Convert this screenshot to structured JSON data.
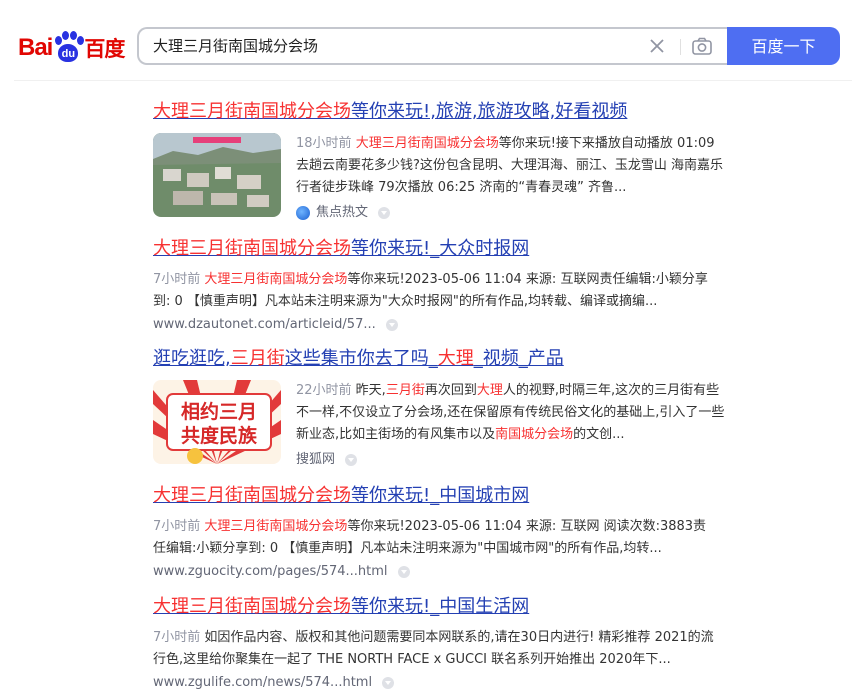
{
  "logo": {
    "bai": "Bai",
    "du": "du",
    "baidu": "百度"
  },
  "search": {
    "query": "大理三月街南国城分会场",
    "button_label": "百度一下"
  },
  "results": [
    {
      "title_parts": [
        "大理三月街南国城分会场",
        "等你来玩!,旅游,旅游攻略,好看视频"
      ],
      "time": "18小时前",
      "snippet_hl": "大理三月街南国城分会场",
      "snippet_rest": "等你来玩!接下来播放自动播放 01:09 去趟云南要花多少钱?这份包含昆明、大理洱海、丽江、玉龙雪山 海南嘉乐行者徒步珠峰 79次播放 06:25 济南的“青春灵魂” 齐鲁...",
      "source": "焦点热文"
    },
    {
      "title_parts": [
        "大理三月街南国城分会场",
        "等你来玩!_大众时报网"
      ],
      "time": "7小时前",
      "snippet_hl": "大理三月街南国城分会场",
      "snippet_rest": "等你来玩!2023-05-06 11:04 来源: 互联网责任编辑:小颖分享到: 0 【慎重声明】凡本站未注明来源为\"大众时报网\"的所有作品,均转载、编译或摘编...",
      "url": "www.dzautonet.com/articleid/57..."
    },
    {
      "title_parts": [
        "逛吃逛吃,",
        "三月街",
        "这些集市你去了吗_",
        "大理",
        "_视频_产品"
      ],
      "time": "22小时前",
      "snippet_parts": [
        " 昨天,",
        "三月街",
        "再次回到",
        "大理",
        "人的视野,时隔三年,这次的三月街有些不一样,不仅设立了分会场,还在保留原有传统民俗文化的基础上,引入了一些新业态,比如主街场的有风集市以及",
        "南国城分会场",
        "的文创..."
      ],
      "thumb_text": [
        "相约三月",
        "共度民族"
      ],
      "source": "搜狐网"
    },
    {
      "title_parts": [
        "大理三月街南国城分会场",
        "等你来玩!_中国城市网"
      ],
      "time": "7小时前",
      "snippet_hl": "大理三月街南国城分会场",
      "snippet_rest": "等你来玩!2023-05-06 11:04 来源: 互联网 阅读次数:3883责任编辑:小颖分享到: 0 【慎重声明】凡本站未注明来源为\"中国城市网\"的所有作品,均转...",
      "url": "www.zguocity.com/pages/574...html"
    },
    {
      "title_parts": [
        "大理三月街南国城分会场",
        "等你来玩!_中国生活网"
      ],
      "time": "7小时前",
      "snippet_rest": " 如因作品内容、版权和其他问题需要同本网联系的,请在30日内进行! 精彩推荐 2021的流行色,这里给你聚集在一起了 THE NORTH FACE x GUCCI 联名系列开始推出 2020年下...",
      "url": "www.zgulife.com/news/574...html"
    }
  ],
  "colors": {
    "accent": "#4e6ef2",
    "link": "#2440b3",
    "highlight": "#f73131"
  }
}
